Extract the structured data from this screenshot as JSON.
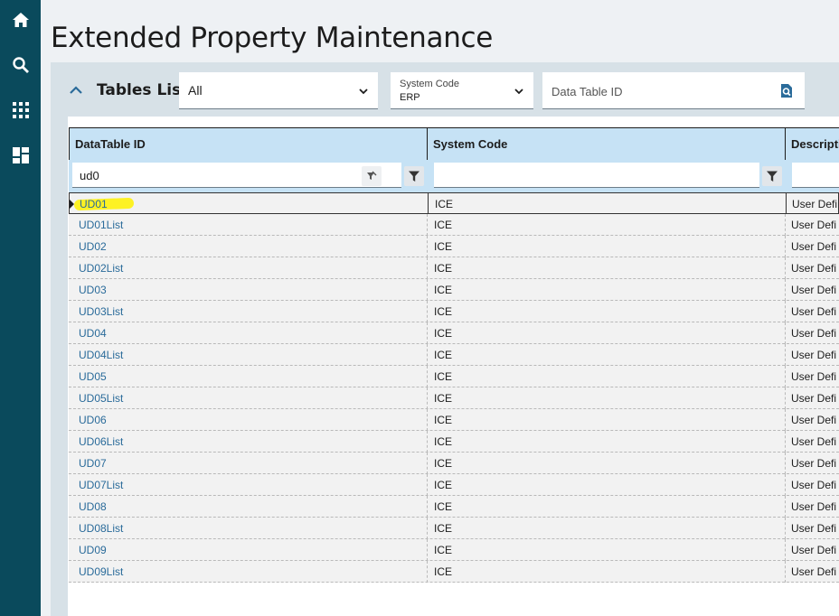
{
  "page": {
    "title": "Extended Property Maintenance"
  },
  "rail": {
    "icons": [
      "home-icon",
      "search-icon",
      "apps-grid-icon",
      "dashboard-icon"
    ]
  },
  "panel": {
    "heading": "Tables List",
    "filter_select": {
      "value": "All"
    },
    "system_code": {
      "label": "System Code",
      "value": "ERP"
    },
    "data_table_id": {
      "placeholder": "Data Table ID"
    }
  },
  "grid": {
    "columns": [
      "DataTable ID",
      "System Code",
      "Descripti"
    ],
    "filter_value": "ud0",
    "rows": [
      {
        "id": "UD01",
        "system": "ICE",
        "desc": "User Defi"
      },
      {
        "id": "UD01List",
        "system": "ICE",
        "desc": "User Defi"
      },
      {
        "id": "UD02",
        "system": "ICE",
        "desc": "User Defi"
      },
      {
        "id": "UD02List",
        "system": "ICE",
        "desc": "User Defi"
      },
      {
        "id": "UD03",
        "system": "ICE",
        "desc": "User Defi"
      },
      {
        "id": "UD03List",
        "system": "ICE",
        "desc": "User Defi"
      },
      {
        "id": "UD04",
        "system": "ICE",
        "desc": "User Defi"
      },
      {
        "id": "UD04List",
        "system": "ICE",
        "desc": "User Defi"
      },
      {
        "id": "UD05",
        "system": "ICE",
        "desc": "User Defi"
      },
      {
        "id": "UD05List",
        "system": "ICE",
        "desc": "User Defi"
      },
      {
        "id": "UD06",
        "system": "ICE",
        "desc": "User Defi"
      },
      {
        "id": "UD06List",
        "system": "ICE",
        "desc": "User Defi"
      },
      {
        "id": "UD07",
        "system": "ICE",
        "desc": "User Defi"
      },
      {
        "id": "UD07List",
        "system": "ICE",
        "desc": "User Defi"
      },
      {
        "id": "UD08",
        "system": "ICE",
        "desc": "User Defi"
      },
      {
        "id": "UD08List",
        "system": "ICE",
        "desc": "User Defi"
      },
      {
        "id": "UD09",
        "system": "ICE",
        "desc": "User Defi"
      },
      {
        "id": "UD09List",
        "system": "ICE",
        "desc": "User Defi"
      }
    ],
    "selected_row": 0
  },
  "colors": {
    "rail": "#0a4a5c",
    "header": "#c6e2f5",
    "link": "#2a6b9a",
    "highlight": "#fff200"
  }
}
